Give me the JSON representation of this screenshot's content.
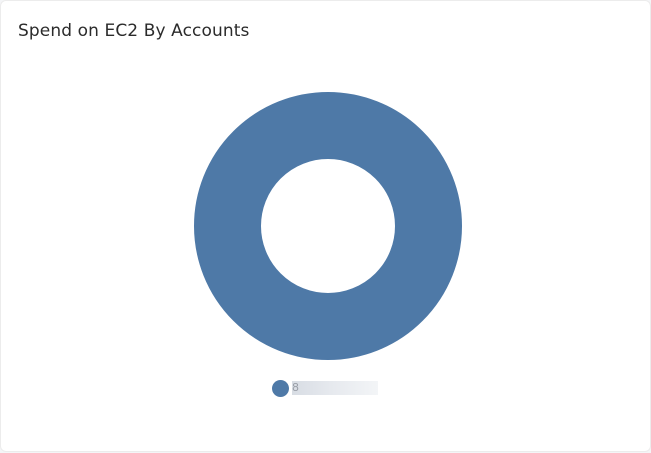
{
  "card": {
    "title": "Spend on EC2 By Accounts"
  },
  "chart_data": {
    "type": "pie",
    "title": "Spend on EC2 By Accounts",
    "donut": true,
    "series": [
      {
        "values": [
          100
        ],
        "colors": [
          "#4e79a7"
        ]
      }
    ],
    "legend": {
      "position": "bottom",
      "entries": [
        {
          "label": "8",
          "color": "#4e79a7",
          "label_obscured": true
        }
      ]
    }
  }
}
